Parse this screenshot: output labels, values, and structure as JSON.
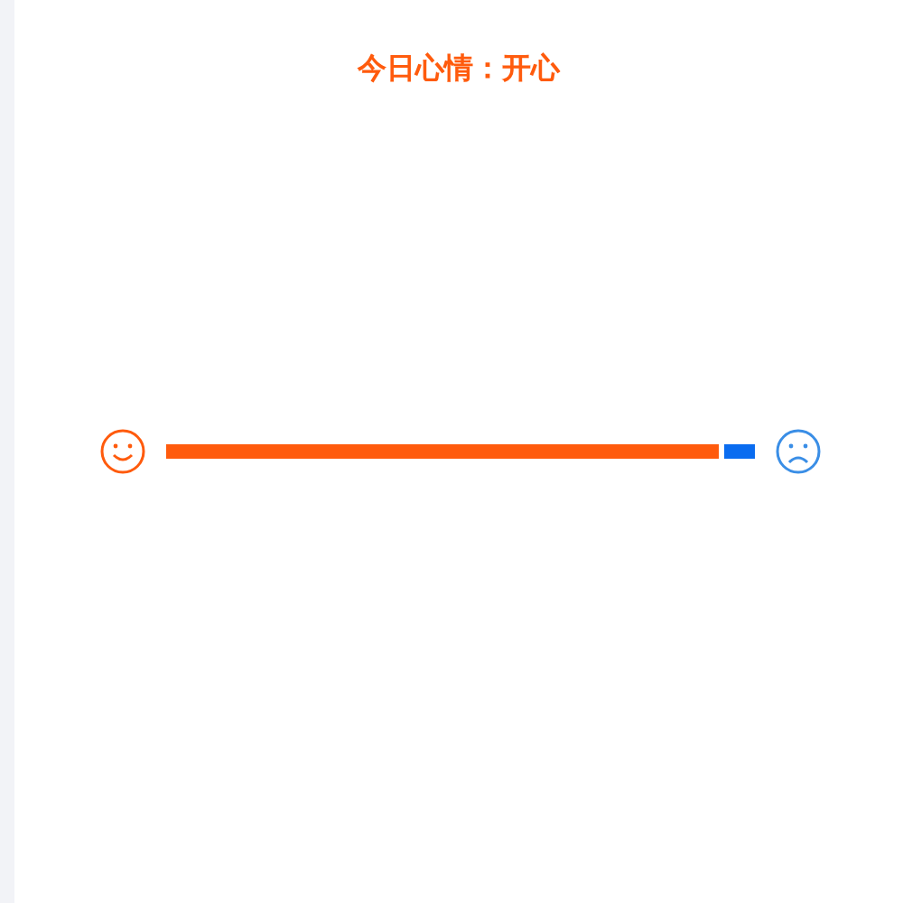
{
  "title": "今日心情：开心",
  "mood_slider": {
    "level": 0.94
  }
}
